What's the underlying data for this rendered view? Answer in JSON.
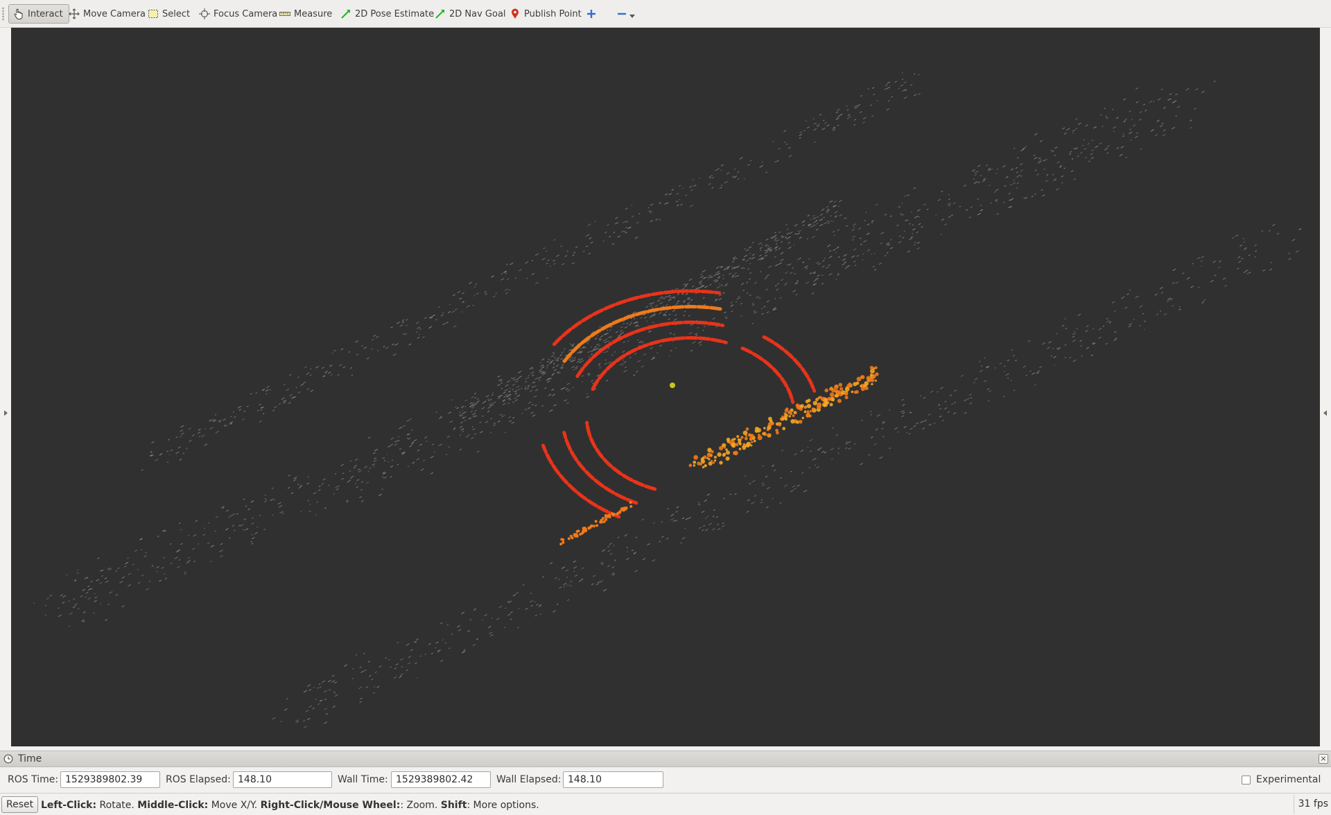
{
  "toolbar": {
    "tools": [
      {
        "label": "Interact",
        "icon": "hand-pointer-icon",
        "active": true
      },
      {
        "label": "Move Camera",
        "icon": "move-arrows-icon"
      },
      {
        "label": "Select",
        "icon": "select-box-icon"
      },
      {
        "label": "Focus Camera",
        "icon": "focus-crosshair-icon"
      },
      {
        "label": "Measure",
        "icon": "ruler-icon"
      },
      {
        "label": "2D Pose Estimate",
        "icon": "green-arrow-icon"
      },
      {
        "label": "2D Nav Goal",
        "icon": "green-arrow-icon"
      },
      {
        "label": "Publish Point",
        "icon": "map-pin-icon"
      }
    ],
    "add_tool_icon": "plus-icon",
    "remove_tool_icon": "minus-icon"
  },
  "viewport": {
    "background": "#303030",
    "point_colors": {
      "ground": "#8a8a8a",
      "near": "#e8331a",
      "mid": "#f07a1a",
      "high": "#f5a623",
      "marker": "#c8c818"
    }
  },
  "time_panel": {
    "title": "Time",
    "ros_time_label": "ROS Time:",
    "ros_time": "1529389802.39",
    "ros_elapsed_label": "ROS Elapsed:",
    "ros_elapsed": "148.10",
    "wall_time_label": "Wall Time:",
    "wall_time": "1529389802.42",
    "wall_elapsed_label": "Wall Elapsed:",
    "wall_elapsed": "148.10",
    "experimental_label": "Experimental",
    "experimental_checked": false
  },
  "statusbar": {
    "reset_label": "Reset",
    "help": [
      {
        "key": "Left-Click:",
        "text": " Rotate. "
      },
      {
        "key": "Middle-Click:",
        "text": " Move X/Y. "
      },
      {
        "key": "Right-Click/Mouse Wheel:",
        "text": ": Zoom. "
      },
      {
        "key": "Shift",
        "text": ": More options."
      }
    ],
    "fps": "31 fps"
  }
}
